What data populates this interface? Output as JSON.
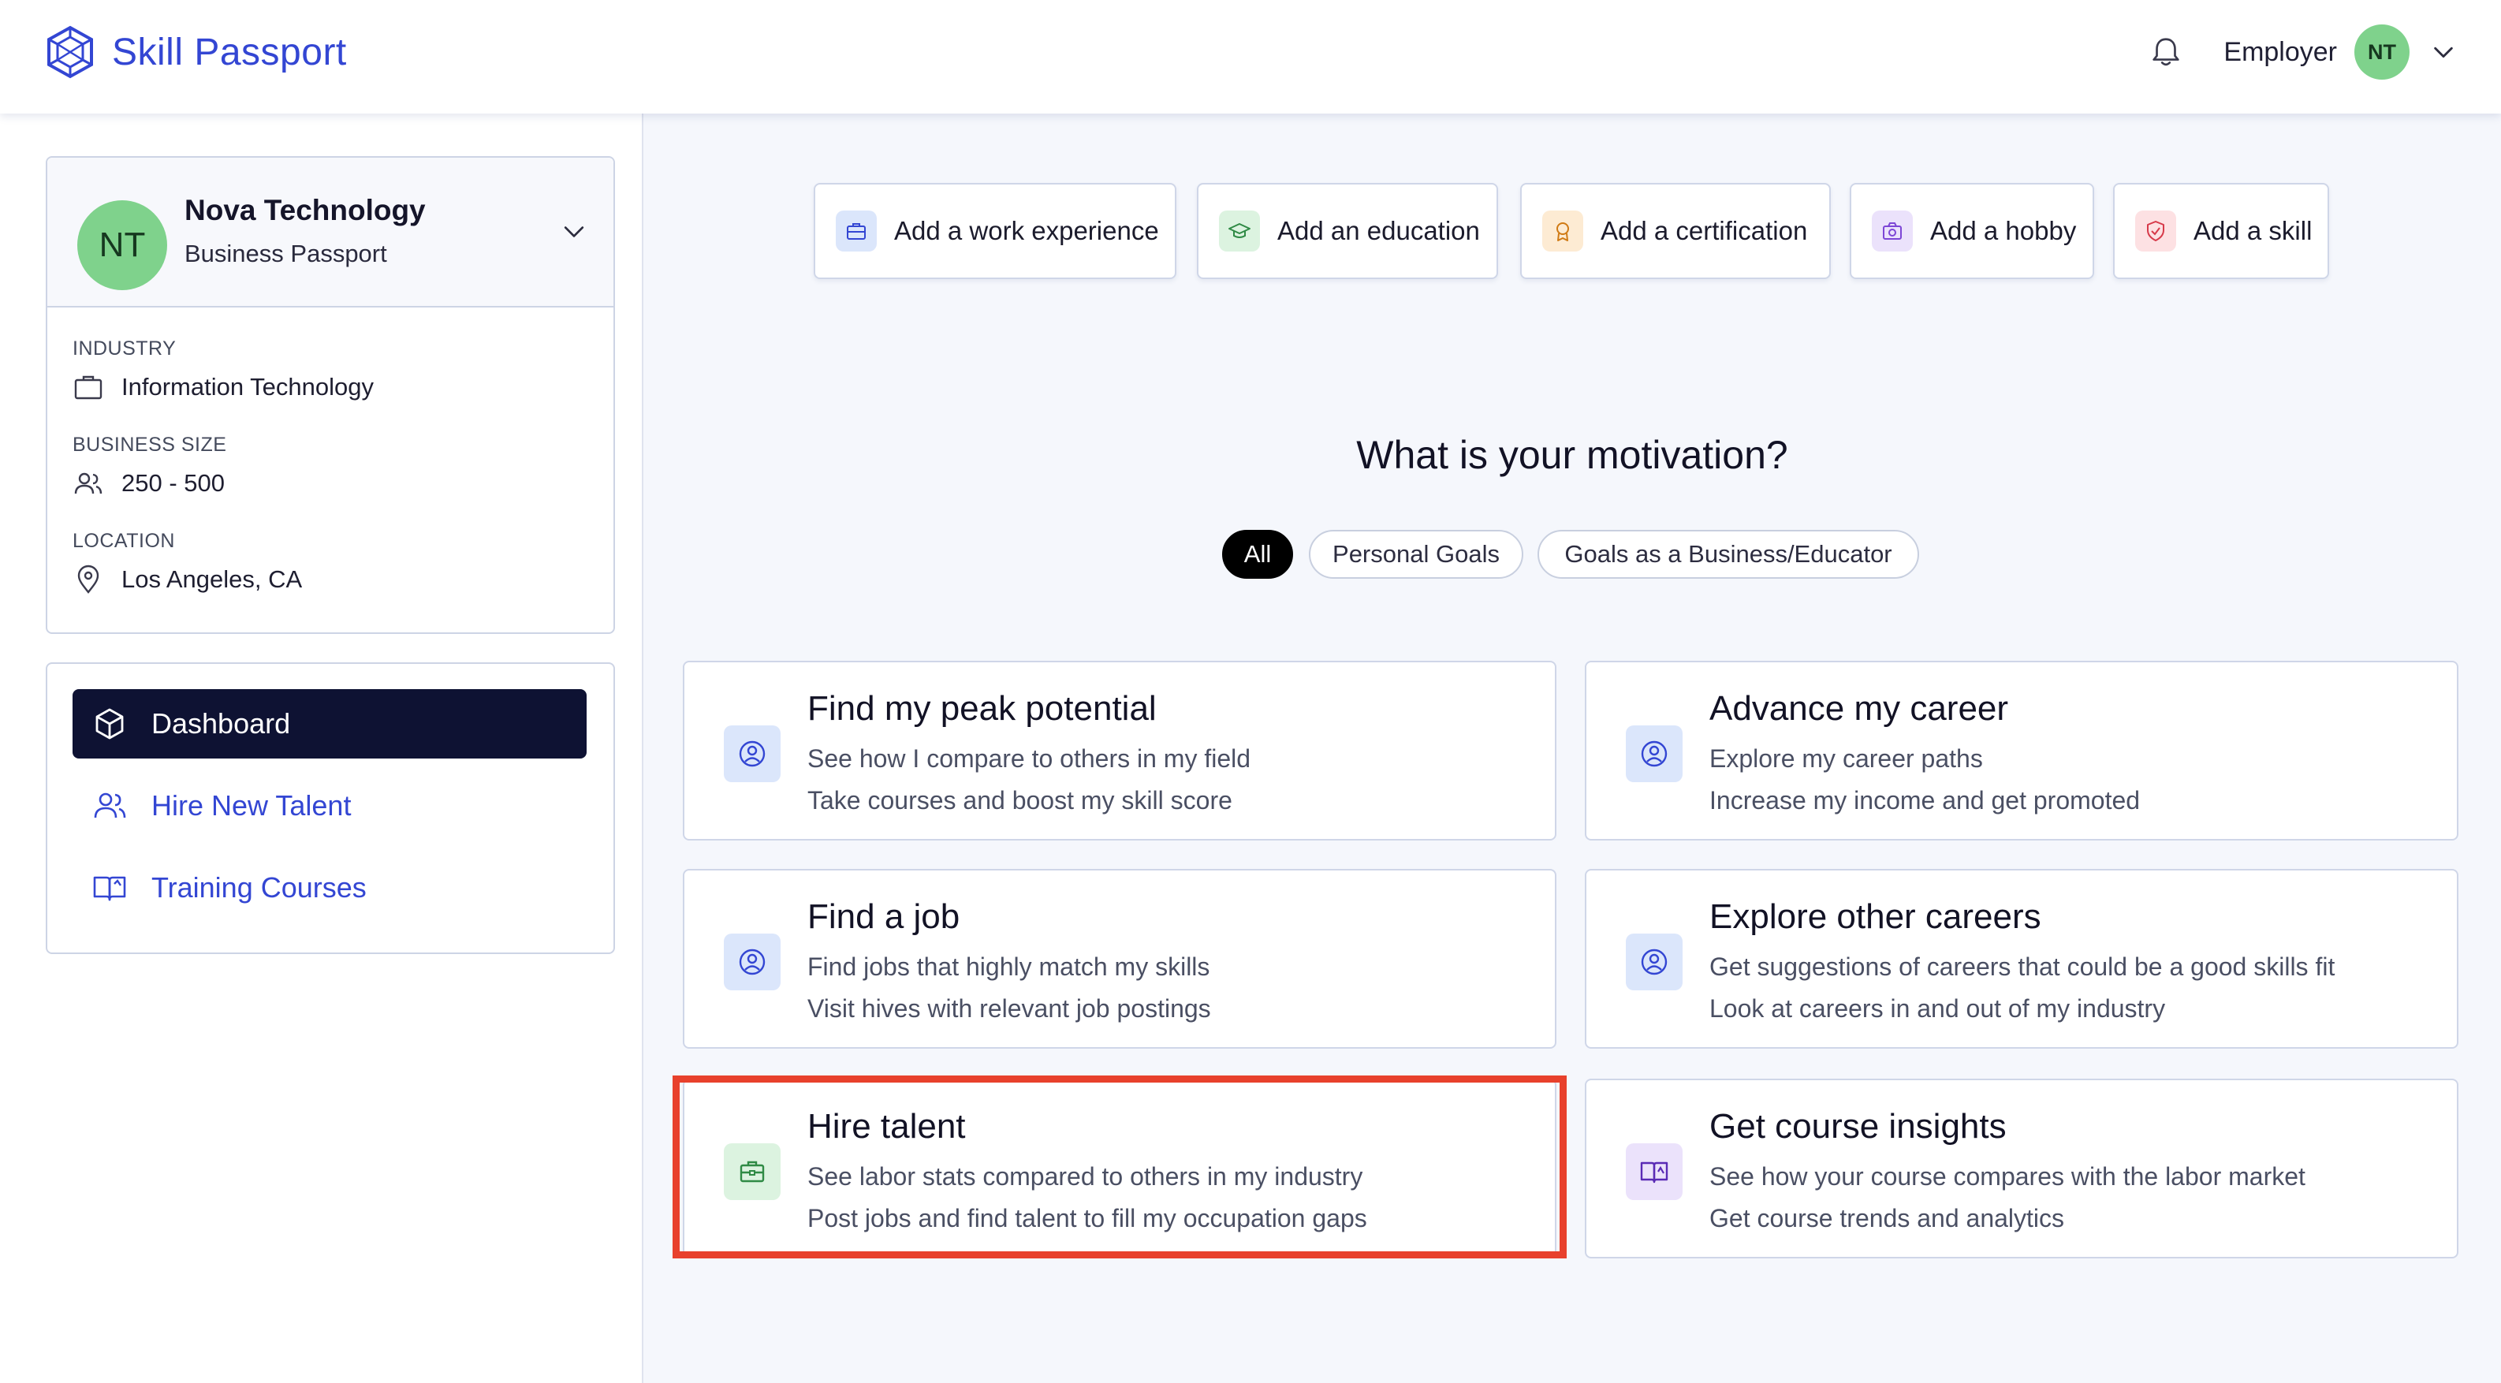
{
  "app": {
    "brand": "Skill Passport",
    "role_label": "Employer",
    "user_initials": "NT",
    "accent_color": "#3346d3"
  },
  "profile": {
    "initials": "NT",
    "company_name": "Nova Technology",
    "passport_type": "Business Passport",
    "industry_label": "INDUSTRY",
    "industry_value": "Information Technology",
    "size_label": "BUSINESS SIZE",
    "size_value": "250 - 500",
    "location_label": "LOCATION",
    "location_value": "Los Angeles, CA"
  },
  "nav": {
    "items": [
      {
        "label": "Dashboard",
        "icon": "cube-icon",
        "active": true
      },
      {
        "label": "Hire New Talent",
        "icon": "users-icon",
        "active": false
      },
      {
        "label": "Training Courses",
        "icon": "book-open-icon",
        "active": false
      }
    ]
  },
  "quick_actions": [
    {
      "label": "Add a work experience",
      "icon": "briefcase-icon",
      "color": "#dbe6fb"
    },
    {
      "label": "Add an education",
      "icon": "graduation-cap-icon",
      "color": "#dcf3e0"
    },
    {
      "label": "Add a certification",
      "icon": "award-icon",
      "color": "#fdebd3"
    },
    {
      "label": "Add a hobby",
      "icon": "camera-icon",
      "color": "#ebe2fb"
    },
    {
      "label": "Add a skill",
      "icon": "shield-check-icon",
      "color": "#fde1e3"
    }
  ],
  "motivation": {
    "title": "What is your motivation?",
    "filters": [
      "All",
      "Personal Goals",
      "Goals as a Business/Educator"
    ],
    "selected_filter": "All"
  },
  "goals": [
    {
      "title": "Find my peak potential",
      "line1": "See how I compare to others in my field",
      "line2": "Take courses and boost my skill score",
      "icon": "user-circle-icon"
    },
    {
      "title": "Advance my career",
      "line1": "Explore my career paths",
      "line2": "Increase my income and get promoted",
      "icon": "user-circle-icon"
    },
    {
      "title": "Find a job",
      "line1": "Find jobs that highly match my skills",
      "line2": "Visit hives with relevant job postings",
      "icon": "user-circle-icon"
    },
    {
      "title": "Explore other careers",
      "line1": "Get suggestions of careers that could be a good skills fit",
      "line2": "Look at careers in and out of my industry",
      "icon": "user-circle-icon"
    },
    {
      "title": "Hire talent",
      "line1": "See labor stats compared to others in my industry",
      "line2": "Post jobs and find talent to fill my occupation gaps",
      "icon": "briefcase-icon",
      "highlighted": true
    },
    {
      "title": "Get course insights",
      "line1": "See how your course compares with the labor market",
      "line2": "Get course trends and analytics",
      "icon": "book-open-icon"
    }
  ]
}
